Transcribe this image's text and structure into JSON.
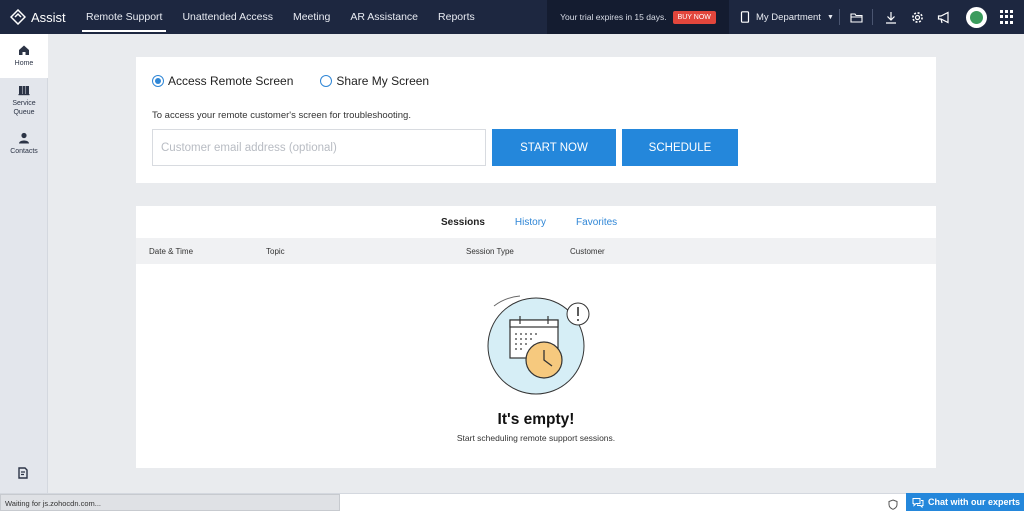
{
  "app": {
    "brand": "Assist"
  },
  "nav": {
    "items": [
      {
        "label": "Remote Support",
        "active": true
      },
      {
        "label": "Unattended Access"
      },
      {
        "label": "Meeting"
      },
      {
        "label": "AR Assistance"
      },
      {
        "label": "Reports"
      }
    ]
  },
  "trial": {
    "text": "Your trial expires in 15 days.",
    "buy_label": "BUY NOW"
  },
  "department": {
    "label": "My Department"
  },
  "toolbar_icons": [
    "folder-icon",
    "download-icon",
    "gear-icon",
    "megaphone-icon",
    "avatar",
    "apps-grid-icon"
  ],
  "sidebar": {
    "items": [
      {
        "label": "Home",
        "icon": "home-icon",
        "active": true
      },
      {
        "label": "Service Queue",
        "icon": "service-queue-icon"
      },
      {
        "label": "Contacts",
        "icon": "contacts-icon"
      }
    ],
    "bottom_icon": "notes-icon"
  },
  "remote": {
    "options": [
      {
        "label": "Access Remote Screen",
        "selected": true
      },
      {
        "label": "Share My Screen",
        "selected": false
      }
    ],
    "description": "To access your remote customer's screen for troubleshooting.",
    "email_placeholder": "Customer email address (optional)",
    "start_label": "START NOW",
    "schedule_label": "SCHEDULE"
  },
  "sessions": {
    "tabs": [
      {
        "label": "Sessions",
        "active": true
      },
      {
        "label": "History"
      },
      {
        "label": "Favorites"
      }
    ],
    "columns": [
      "Date & Time",
      "Topic",
      "Session Type",
      "Customer"
    ],
    "empty_title": "It's empty!",
    "empty_subtitle": "Start scheduling remote support sessions."
  },
  "status_bar": {
    "text": "Waiting for js.zohocdn.com..."
  },
  "chat": {
    "label": "Chat with our experts"
  },
  "colors": {
    "topbar": "#1d2740",
    "accent": "#2487db",
    "buy": "#e2463c"
  }
}
